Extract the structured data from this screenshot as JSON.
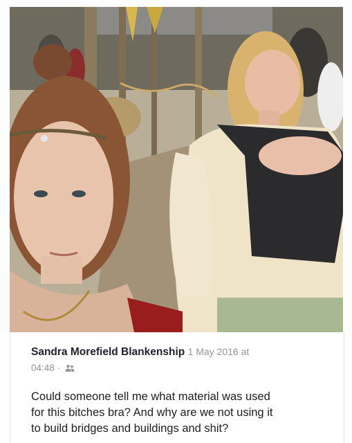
{
  "post": {
    "author": "Sandra Morefield Blankenship",
    "date": "1 May 2016 at",
    "time": "04:48",
    "separator": "·",
    "audience_icon": "friends-icon",
    "text_line1": "Could someone tell me what material was used",
    "text_line2": "for this bitches bra? And why are we not using it",
    "text_line3": "to build bridges and buildings and shit?"
  },
  "photo": {
    "description_icon": "post-photo"
  }
}
